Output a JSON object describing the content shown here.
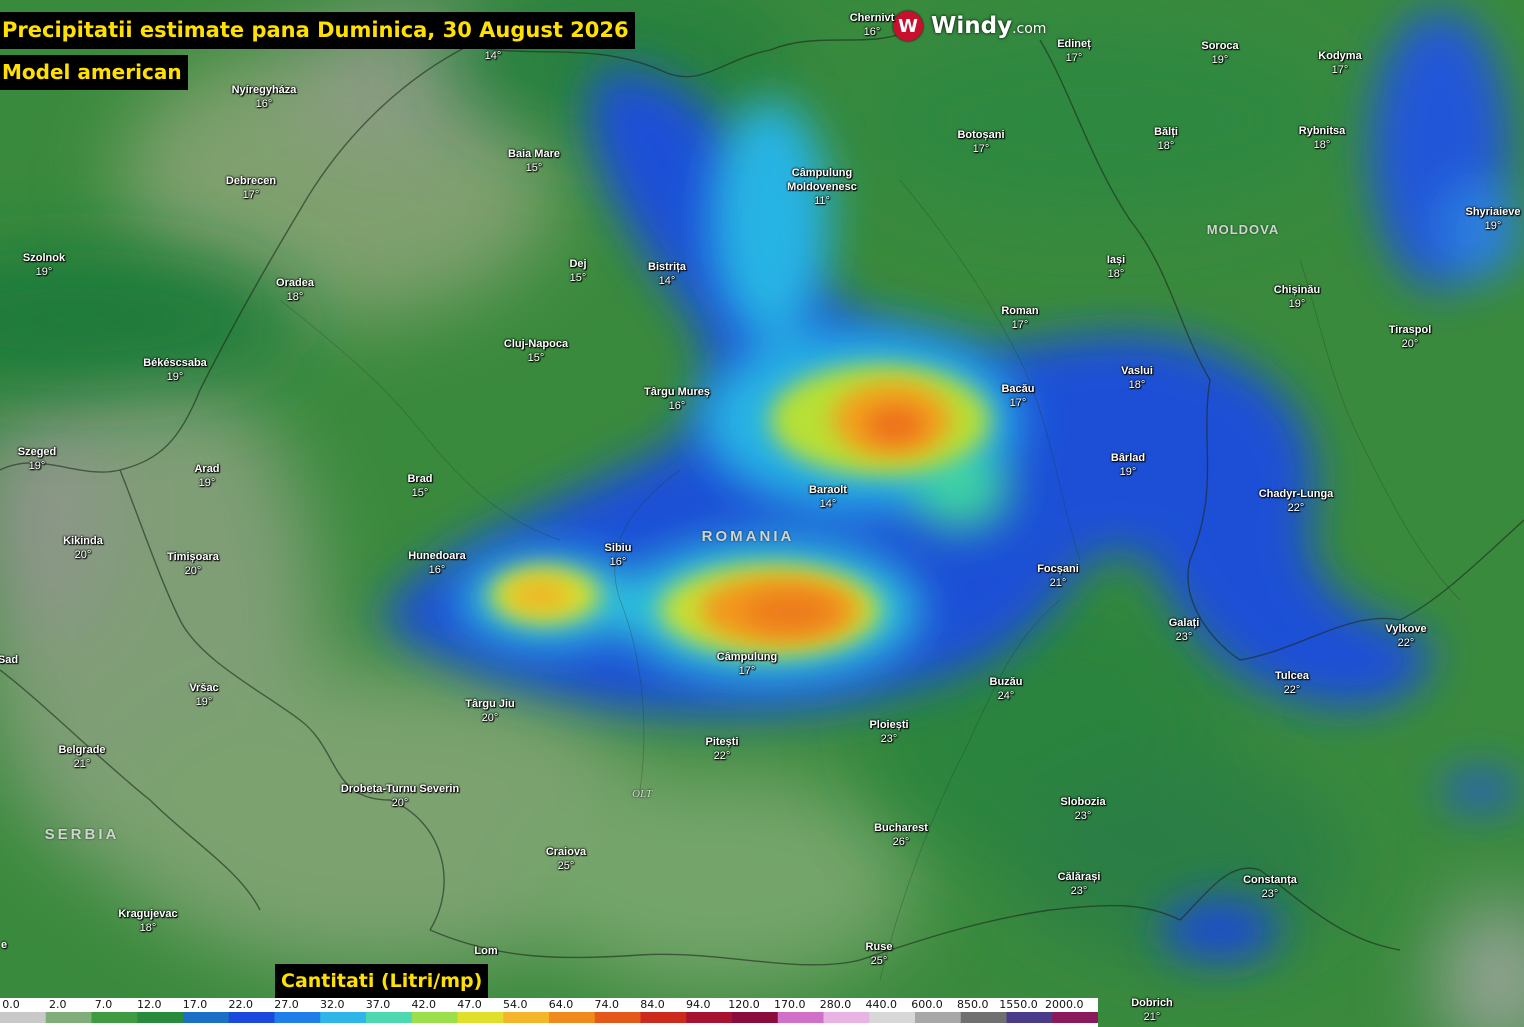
{
  "title": "Precipitatii estimate pana Duminica, 30 August 2026",
  "subtitle": "Model american",
  "legend_title": "Cantitati (Litri/mp)",
  "brand": {
    "name": "Windy",
    "suffix": ".com",
    "icon": "windy-w-icon",
    "color": "#c8102e"
  },
  "river_label": "OLT",
  "countries": [
    {
      "id": "romania",
      "label": "ROMANIA"
    },
    {
      "id": "moldova",
      "label": "MOLDOVA"
    },
    {
      "id": "serbia",
      "label": "SERBIA"
    }
  ],
  "cities": [
    {
      "id": "chernivtsi",
      "name": "Chernivt",
      "temp": "16°"
    },
    {
      "id": "north-unnamed",
      "name": "",
      "temp": "14°"
    },
    {
      "id": "nyiregyhaza",
      "name": "Nyíregyháza",
      "temp": "16°"
    },
    {
      "id": "baia-mare",
      "name": "Baia Mare",
      "temp": "15°"
    },
    {
      "id": "debrecen",
      "name": "Debrecen",
      "temp": "17°"
    },
    {
      "id": "szolnok",
      "name": "Szolnok",
      "temp": "19°"
    },
    {
      "id": "oradea",
      "name": "Oradea",
      "temp": "18°"
    },
    {
      "id": "dej",
      "name": "Dej",
      "temp": "15°"
    },
    {
      "id": "bistrita",
      "name": "Bistrița",
      "temp": "14°"
    },
    {
      "id": "campulung-moldovenesc",
      "name": "Câmpulung\nMoldovenesc",
      "temp": "11°"
    },
    {
      "id": "edinet",
      "name": "Edineț",
      "temp": "17°"
    },
    {
      "id": "soroca",
      "name": "Soroca",
      "temp": "19°"
    },
    {
      "id": "kodyma",
      "name": "Kodyma",
      "temp": "17°"
    },
    {
      "id": "botosani",
      "name": "Botoșani",
      "temp": "17°"
    },
    {
      "id": "balti",
      "name": "Bălți",
      "temp": "18°"
    },
    {
      "id": "rybnitsa",
      "name": "Rybnitsa",
      "temp": "18°"
    },
    {
      "id": "shyriaieve",
      "name": "Shyriaieve",
      "temp": "19°"
    },
    {
      "id": "iasi",
      "name": "Iași",
      "temp": "18°"
    },
    {
      "id": "chisinau",
      "name": "Chișinău",
      "temp": "19°"
    },
    {
      "id": "roman",
      "name": "Roman",
      "temp": "17°"
    },
    {
      "id": "tiraspol",
      "name": "Tiraspol",
      "temp": "20°"
    },
    {
      "id": "cluj-napoca",
      "name": "Cluj-Napoca",
      "temp": "15°"
    },
    {
      "id": "bekescsaba",
      "name": "Békéscsaba",
      "temp": "19°"
    },
    {
      "id": "targu-mures",
      "name": "Târgu Mureș",
      "temp": "16°"
    },
    {
      "id": "bacau",
      "name": "Bacău",
      "temp": "17°"
    },
    {
      "id": "vaslui",
      "name": "Vaslui",
      "temp": "18°"
    },
    {
      "id": "szeged",
      "name": "Szeged",
      "temp": "19°"
    },
    {
      "id": "arad",
      "name": "Arad",
      "temp": "19°"
    },
    {
      "id": "brad",
      "name": "Brad",
      "temp": "15°"
    },
    {
      "id": "barlad",
      "name": "Bârlad",
      "temp": "19°"
    },
    {
      "id": "baraolt",
      "name": "Baraolt",
      "temp": "14°"
    },
    {
      "id": "chadyr-lunga",
      "name": "Chadyr-Lunga",
      "temp": "22°"
    },
    {
      "id": "kikinda",
      "name": "Kikinda",
      "temp": "20°"
    },
    {
      "id": "timisoara",
      "name": "Timișoara",
      "temp": "20°"
    },
    {
      "id": "hunedoara",
      "name": "Hunedoara",
      "temp": "16°"
    },
    {
      "id": "sibiu",
      "name": "Sibiu",
      "temp": "16°"
    },
    {
      "id": "focsani",
      "name": "Focșani",
      "temp": "21°"
    },
    {
      "id": "galati",
      "name": "Galați",
      "temp": "23°"
    },
    {
      "id": "vylkove",
      "name": "Vylkove",
      "temp": "22°"
    },
    {
      "id": "novi-sad",
      "name": "Sad",
      "temp": ""
    },
    {
      "id": "campulung",
      "name": "Câmpulung",
      "temp": "17°"
    },
    {
      "id": "tulcea",
      "name": "Tulcea",
      "temp": "22°"
    },
    {
      "id": "buzau",
      "name": "Buzău",
      "temp": "24°"
    },
    {
      "id": "vrsac",
      "name": "Vršac",
      "temp": "19°"
    },
    {
      "id": "targu-jiu",
      "name": "Târgu Jiu",
      "temp": "20°"
    },
    {
      "id": "ploiesti",
      "name": "Ploiești",
      "temp": "23°"
    },
    {
      "id": "pitesti",
      "name": "Pitești",
      "temp": "22°"
    },
    {
      "id": "belgrade",
      "name": "Belgrade",
      "temp": "21°"
    },
    {
      "id": "drobeta",
      "name": "Drobeta-Turnu Severin",
      "temp": "20°"
    },
    {
      "id": "slobozia",
      "name": "Slobozia",
      "temp": "23°"
    },
    {
      "id": "bucharest",
      "name": "Bucharest",
      "temp": "26°"
    },
    {
      "id": "craiova",
      "name": "Craiova",
      "temp": "25°"
    },
    {
      "id": "calarasi",
      "name": "Călărași",
      "temp": "23°"
    },
    {
      "id": "constanta",
      "name": "Constanța",
      "temp": "23°"
    },
    {
      "id": "kragujevac",
      "name": "Kragujevac",
      "temp": "18°"
    },
    {
      "id": "lom",
      "name": "Lom",
      "temp": ""
    },
    {
      "id": "ruse",
      "name": "Ruse",
      "temp": "25°"
    },
    {
      "id": "dobrich",
      "name": "Dobrich",
      "temp": "21°"
    },
    {
      "id": "west-edge",
      "name": "e",
      "temp": ""
    }
  ],
  "scale": {
    "ticks": [
      "0.0",
      "2.0",
      "7.0",
      "12.0",
      "17.0",
      "22.0",
      "27.0",
      "32.0",
      "37.0",
      "42.0",
      "47.0",
      "54.0",
      "64.0",
      "74.0",
      "84.0",
      "94.0",
      "120.0",
      "170.0",
      "280.0",
      "440.0",
      "600.0",
      "850.0",
      "1550.0",
      "2000.0"
    ],
    "colors": [
      "#c9c9c9",
      "#7fae7a",
      "#3f9a42",
      "#2a8a3c",
      "#1b6fc4",
      "#1c49dd",
      "#1f7ee8",
      "#2fb5e8",
      "#4ed8b0",
      "#9be04a",
      "#e0e02a",
      "#f4b52a",
      "#f08a1c",
      "#e4581a",
      "#cc2a1c",
      "#a81232",
      "#8a0c3c",
      "#d070c8",
      "#e8b4e4",
      "#d8d8d8",
      "#a8a8a8",
      "#707070",
      "#4a3c8a",
      "#8a1a5c"
    ]
  }
}
